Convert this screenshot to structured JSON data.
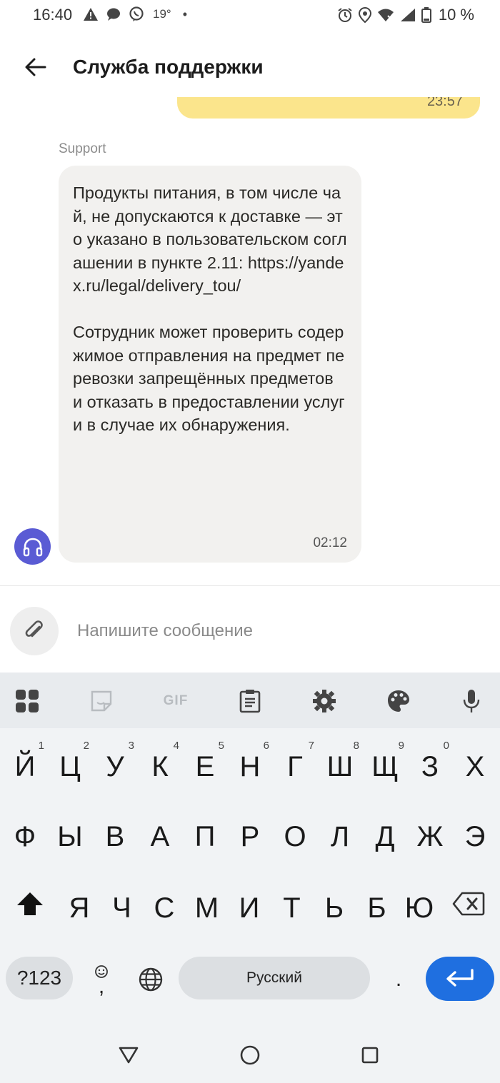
{
  "status_bar": {
    "time": "16:40",
    "temperature": "19°",
    "battery": "10 %"
  },
  "header": {
    "title": "Служба поддержки"
  },
  "chat": {
    "own_message_time": "23:57",
    "sender": "Support",
    "message_text": "Продукты питания, в том числе чай, не допускаются к доставке — это указано в пользовательском соглашении в пункте 2.11: https://yandex.ru/legal/delivery_tou/\n\nСотрудник может проверить содержимое отправления на предмет перевозки запрещённых предметов и отказать в предоставлении услуги в случае их обнаружения.",
    "message_time": "02:12"
  },
  "composer": {
    "placeholder": "Напишите сообщение"
  },
  "keyboard": {
    "toolbar_gif": "GIF",
    "row1": [
      {
        "k": "Й",
        "hint": "1"
      },
      {
        "k": "Ц",
        "hint": "2"
      },
      {
        "k": "У",
        "hint": "3"
      },
      {
        "k": "К",
        "hint": "4"
      },
      {
        "k": "Е",
        "hint": "5"
      },
      {
        "k": "Н",
        "hint": "6"
      },
      {
        "k": "Г",
        "hint": "7"
      },
      {
        "k": "Ш",
        "hint": "8"
      },
      {
        "k": "Щ",
        "hint": "9"
      },
      {
        "k": "З",
        "hint": "0"
      },
      {
        "k": "Х",
        "hint": ""
      }
    ],
    "row2": [
      "Ф",
      "Ы",
      "В",
      "А",
      "П",
      "Р",
      "О",
      "Л",
      "Д",
      "Ж",
      "Э"
    ],
    "row3": [
      "Я",
      "Ч",
      "С",
      "М",
      "И",
      "Т",
      "Ь",
      "Б",
      "Ю"
    ],
    "symbols_key": "?123",
    "comma_key": ",",
    "space_label": "Русский",
    "period_key": "."
  },
  "colors": {
    "own_bubble": "#fbe58c",
    "support_bubble": "#f2f1ef",
    "avatar": "#5a5bd4",
    "enter_key": "#1f6fe0"
  }
}
